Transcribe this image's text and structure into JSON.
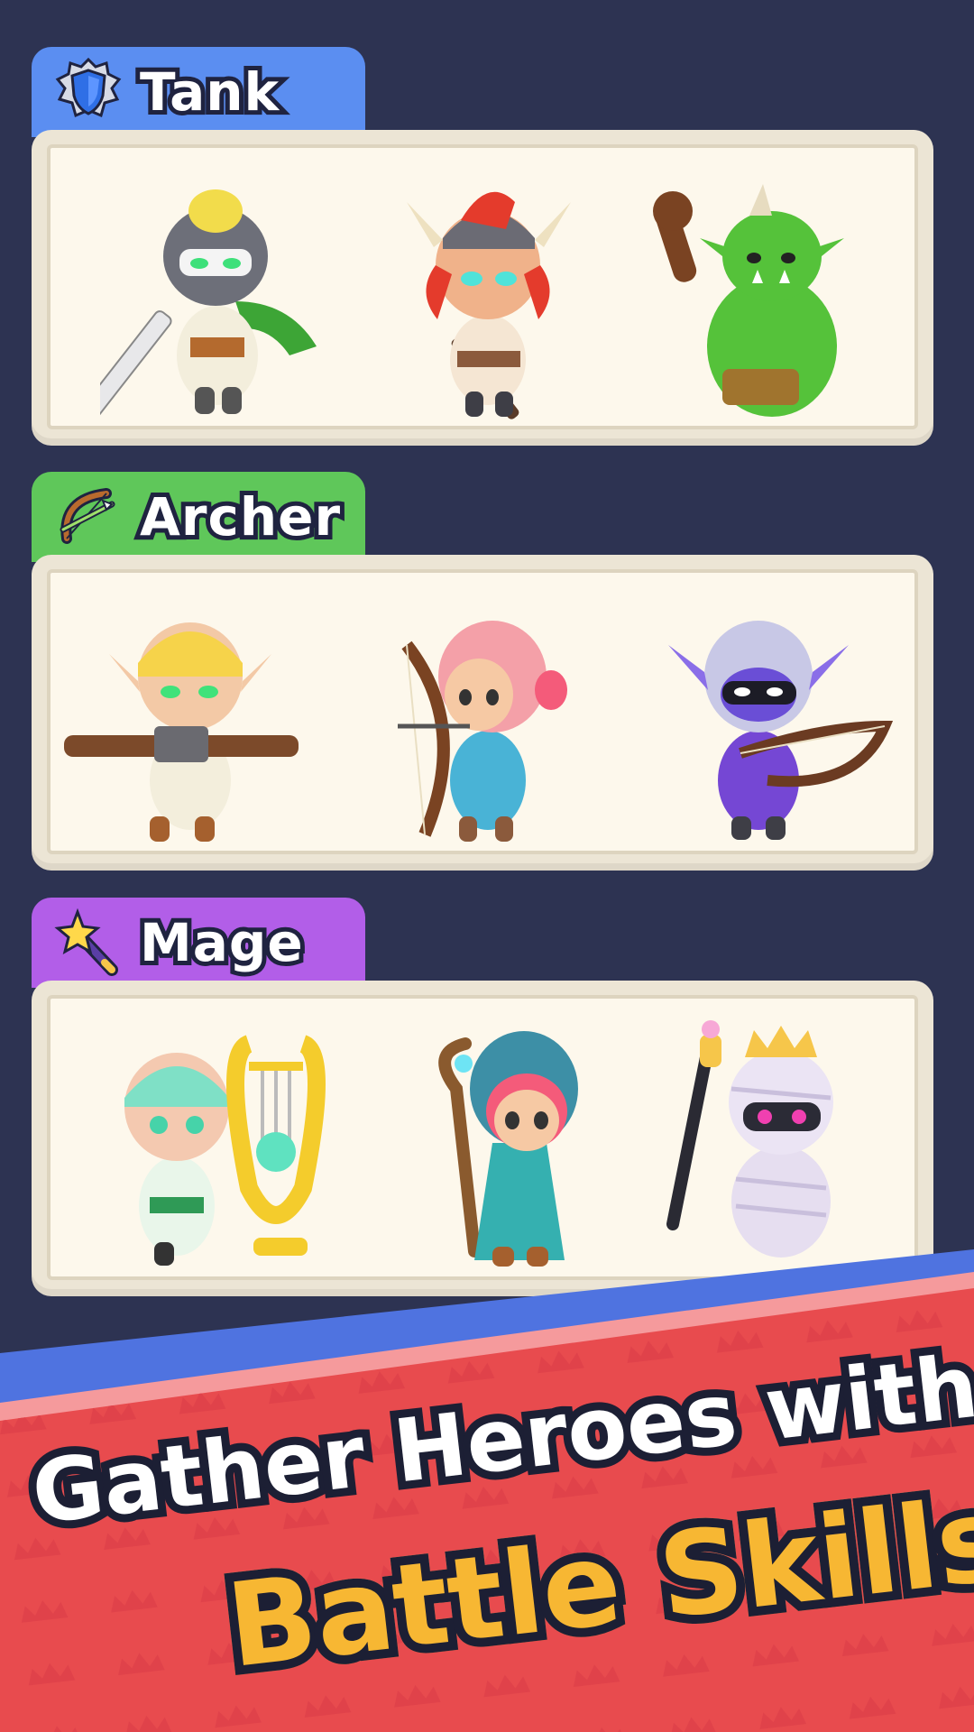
{
  "sections": [
    {
      "label": "Tank",
      "tab_color": "#5b8ef1",
      "icon": "shield-icon",
      "heroes": [
        "knight-hero",
        "viking-hero",
        "orc-hero"
      ]
    },
    {
      "label": "Archer",
      "tab_color": "#5fc75a",
      "icon": "bow-icon",
      "heroes": [
        "elf-crossbow-hero",
        "girl-archer-hero",
        "shadow-elf-archer-hero"
      ]
    },
    {
      "label": "Mage",
      "tab_color": "#b25ee8",
      "icon": "magic-wand-icon",
      "heroes": [
        "lyre-bard-hero",
        "staff-mage-hero",
        "mummy-king-hero"
      ]
    }
  ],
  "banner": {
    "line1": "Gather Heroes with",
    "line2": "Battle Skills!",
    "colors": {
      "stripe": "#4f73e0",
      "band": "#e84b4e",
      "accent": "#f7b733"
    }
  }
}
